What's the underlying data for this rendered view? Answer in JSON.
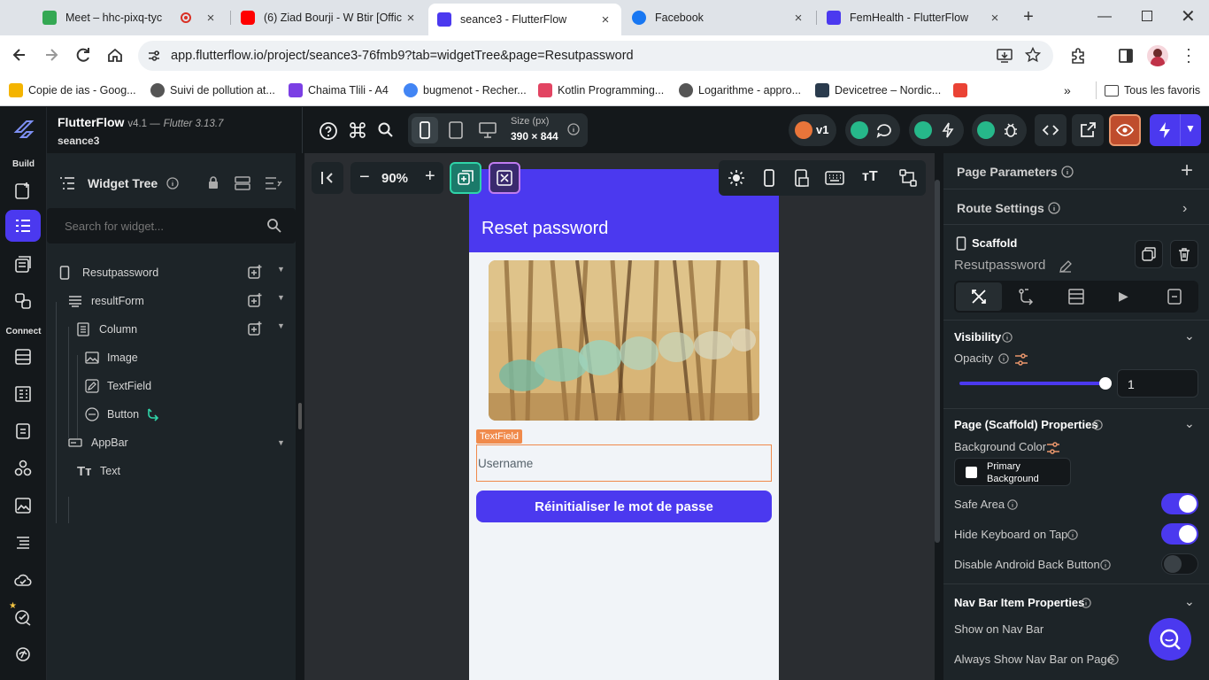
{
  "browser": {
    "tabs": [
      {
        "title": "Meet – hhc-pixq-tyc",
        "fav": "#34a853"
      },
      {
        "title": "(6) Ziad Bourji - W Btir [Offic",
        "fav": "#ff0000"
      },
      {
        "title": "seance3 - FlutterFlow",
        "fav": "#4b39ef"
      },
      {
        "title": "Facebook",
        "fav": "#1877f2"
      },
      {
        "title": "FemHealth - FlutterFlow",
        "fav": "#4b39ef"
      }
    ],
    "url": "app.flutterflow.io/project/seance3-76fmb9?tab=widgetTree&page=Resutpassword",
    "bookmarks": [
      {
        "label": "Copie de ias - Goog...",
        "color": "#f4b400"
      },
      {
        "label": "Suivi de pollution at...",
        "color": "#555555"
      },
      {
        "label": "Chaima Tlili - A4",
        "color": "#7b3fe4"
      },
      {
        "label": "bugmenot - Recher...",
        "color": "#4285f4"
      },
      {
        "label": "Kotlin Programming...",
        "color": "#e24462"
      },
      {
        "label": "Logarithme - appro...",
        "color": "#555555"
      },
      {
        "label": "Devicetree – Nordic...",
        "color": "#2a3b4d"
      },
      {
        "label": "",
        "color": "#ea4335"
      }
    ],
    "all_bookmarks": "Tous les favoris"
  },
  "app": {
    "name": "FlutterFlow",
    "version": "v4.1 —",
    "flutter": "Flutter 3.13.7",
    "project": "seance3",
    "size_label": "Size (px)",
    "size_value": "390 × 844",
    "branch": "v1",
    "accent": "#4b39ef"
  },
  "rail": {
    "build_label": "Build",
    "connect_label": "Connect"
  },
  "tree": {
    "title": "Widget Tree",
    "search_placeholder": "Search for widget...",
    "items": [
      {
        "label": "Resutpassword"
      },
      {
        "label": "resultForm"
      },
      {
        "label": "Column"
      },
      {
        "label": "Image"
      },
      {
        "label": "TextField"
      },
      {
        "label": "Button"
      },
      {
        "label": "AppBar"
      },
      {
        "label": "Text"
      }
    ]
  },
  "canvas": {
    "zoom": "90%",
    "appbar_title": "Reset password",
    "textfield_tag": "TextField",
    "textfield_hint": "Username",
    "button_label": "Réinitialiser le mot de passe"
  },
  "props": {
    "page_parameters": "Page Parameters",
    "route_settings": "Route Settings",
    "widget_type": "Scaffold",
    "widget_name": "Resutpassword",
    "visibility": "Visibility",
    "opacity": "Opacity",
    "opacity_value": "1",
    "scaffold_props": "Page (Scaffold) Properties",
    "bg_color": "Background Color",
    "bg_color_value": "Primary Background",
    "safe_area": "Safe Area",
    "hide_keyboard": "Hide Keyboard on Tap",
    "disable_back": "Disable Android Back Button",
    "nav_props": "Nav Bar Item Properties",
    "show_nav": "Show on Nav Bar",
    "always_nav": "Always Show Nav Bar on Page",
    "safe_area_on": true,
    "hide_keyboard_on": true,
    "disable_back_on": false
  }
}
